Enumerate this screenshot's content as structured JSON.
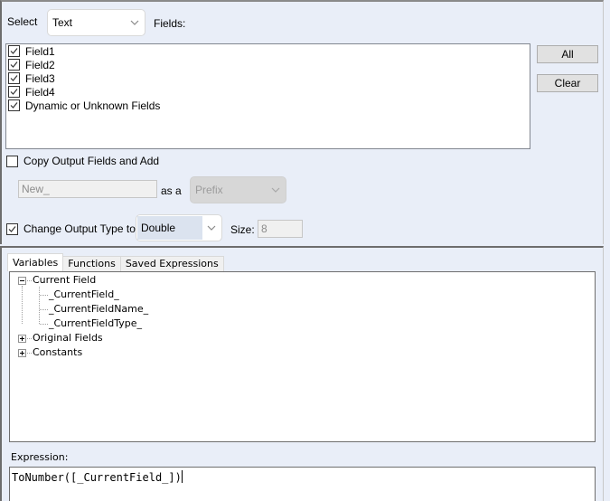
{
  "fields_section": {
    "select_label": "Select",
    "select_value": "Text",
    "fields_label": "Fields:",
    "fields": [
      {
        "label": "Field1",
        "checked": true
      },
      {
        "label": "Field2",
        "checked": true
      },
      {
        "label": "Field3",
        "checked": true
      },
      {
        "label": "Field4",
        "checked": true
      },
      {
        "label": "Dynamic or Unknown Fields",
        "checked": true
      }
    ],
    "all_button": "All",
    "clear_button": "Clear"
  },
  "copy_output": {
    "label": "Copy Output Fields and Add",
    "checked": false,
    "prefix_value": "New_",
    "as_a_label": "as a",
    "position_value": "Prefix"
  },
  "change_type": {
    "label": "Change Output Type to",
    "checked": true,
    "type_value": "Double",
    "size_label": "Size:",
    "size_value": "8"
  },
  "tabs": [
    {
      "label": "Variables",
      "active": true
    },
    {
      "label": "Functions",
      "active": false
    },
    {
      "label": "Saved Expressions",
      "active": false
    }
  ],
  "tree": {
    "current_field": {
      "label": "Current Field",
      "expanded": true,
      "children": [
        "_CurrentField_",
        "_CurrentFieldName_",
        "_CurrentFieldType_"
      ]
    },
    "original_fields": {
      "label": "Original Fields",
      "expanded": false
    },
    "constants": {
      "label": "Constants",
      "expanded": false
    }
  },
  "expression": {
    "label": "Expression:",
    "value": "ToNumber([_CurrentField_])"
  }
}
